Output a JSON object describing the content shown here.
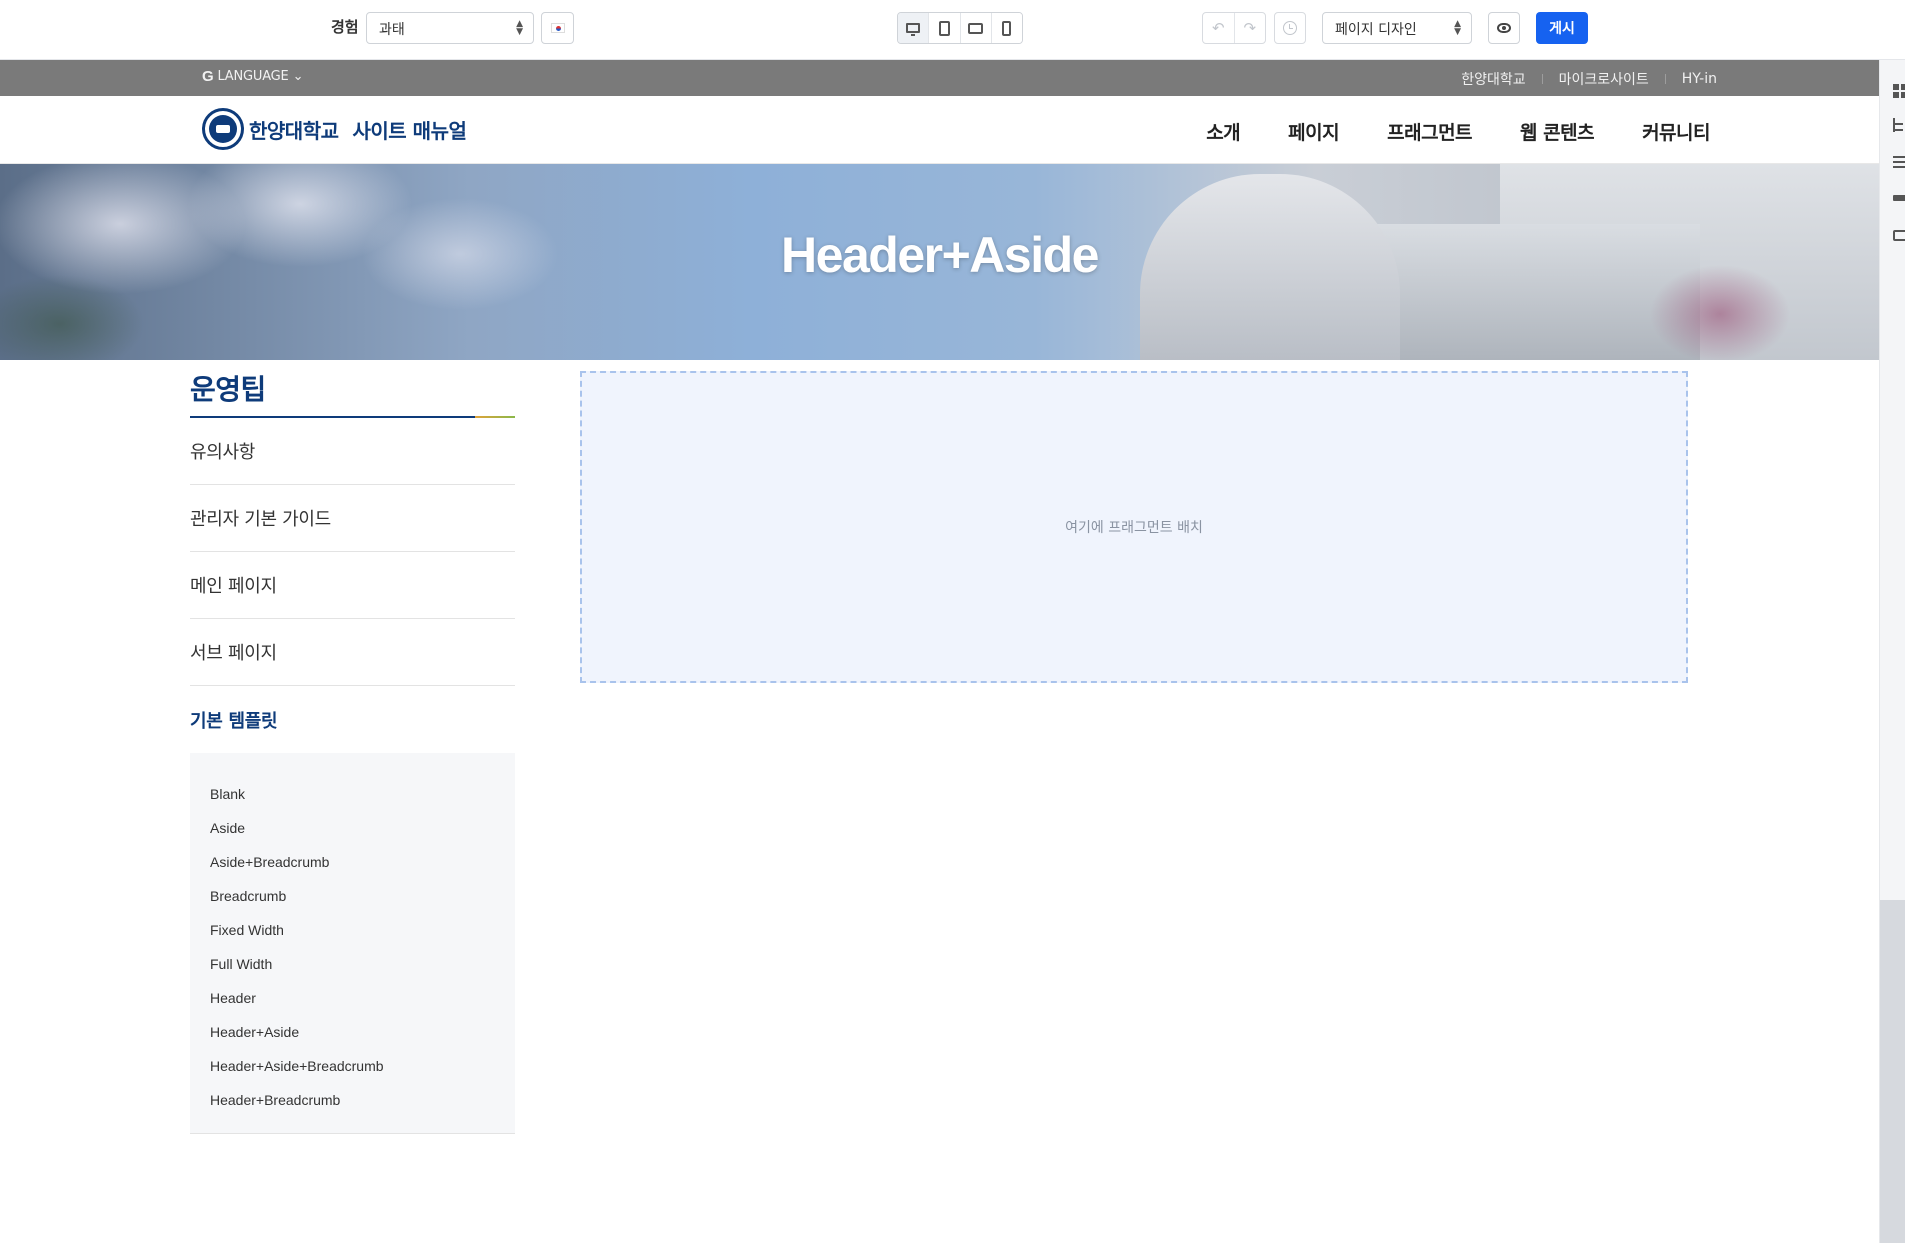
{
  "toolbar": {
    "experience_label": "경험",
    "experience_value": "과태",
    "language_flag": "kr-flag-icon",
    "devices": [
      "desktop-icon",
      "tablet-icon",
      "tablet-landscape-icon",
      "phone-icon"
    ],
    "undo_icon": "↶",
    "redo_icon": "↷",
    "mode_value": "페이지 디자인",
    "publish_label": "게시",
    "accent_color": "#1662f0"
  },
  "site": {
    "utility": {
      "language_label": "LANGUAGE",
      "language_chevron": "⌄",
      "links": [
        "한양대학교",
        "마이크로사이트",
        "HY-in"
      ]
    },
    "logo_name": "한양대학교",
    "logo_sub": "사이트 매뉴얼",
    "nav": [
      "소개",
      "페이지",
      "프래그먼트",
      "웹 콘텐츠",
      "커뮤니티"
    ],
    "brand_color": "#0e3b7a"
  },
  "hero": {
    "title": "Header+Aside"
  },
  "aside": {
    "title": "운영팁",
    "items": [
      "유의사항",
      "관리자 기본 가이드",
      "메인 페이지",
      "서브 페이지"
    ],
    "active_item": "기본 템플릿",
    "sub_items": [
      "Blank",
      "Aside",
      "Aside+Breadcrumb",
      "Breadcrumb",
      "Fixed Width",
      "Full Width",
      "Header",
      "Header+Aside",
      "Header+Aside+Breadcrumb",
      "Header+Breadcrumb"
    ]
  },
  "dropzone": {
    "text": "여기에 프래그먼트 배치"
  }
}
